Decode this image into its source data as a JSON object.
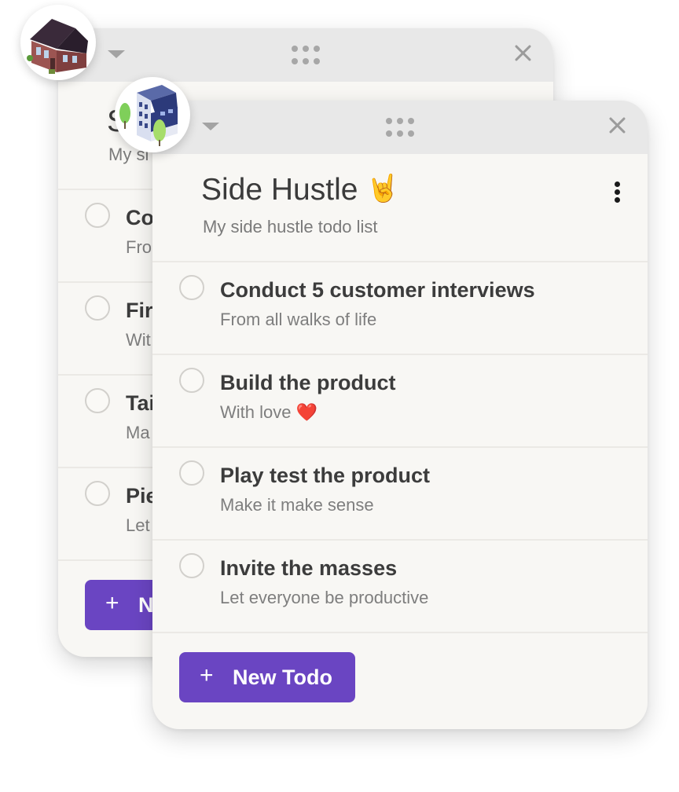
{
  "back_card": {
    "title_fragment": "S",
    "subtitle_fragment": "My si",
    "rows": [
      {
        "title": "Co",
        "subtitle": "Fro"
      },
      {
        "title": "Fir",
        "subtitle": "Wit"
      },
      {
        "title": "Tai",
        "subtitle": "Ma"
      },
      {
        "title": "Pie",
        "subtitle": "Let"
      }
    ],
    "button": {
      "icon": "+",
      "label": "N"
    }
  },
  "front_card": {
    "title": "Side Hustle",
    "title_emoji": "🤘",
    "subtitle": "My side hustle todo list",
    "todos": [
      {
        "title": "Conduct 5 customer interviews",
        "subtitle": "From all walks of life"
      },
      {
        "title": "Build the product",
        "subtitle": "With love",
        "subtitle_emoji": "❤️"
      },
      {
        "title": "Play test the product",
        "subtitle": "Make it make sense"
      },
      {
        "title": "Invite the masses",
        "subtitle": "Let everyone be productive"
      }
    ],
    "button": {
      "icon": "+",
      "label": "New Todo"
    }
  },
  "icons": {
    "collapse": "caret-down-icon",
    "drag": "drag-grip-icon",
    "close": "close-icon",
    "menu": "kebab-menu-icon",
    "back_avatar": "house-icon",
    "front_avatar": "office-building-icon"
  },
  "colors": {
    "accent": "#6a45c2",
    "card_bg": "#f8f7f4",
    "titlebar_bg": "#e8e8e8"
  }
}
